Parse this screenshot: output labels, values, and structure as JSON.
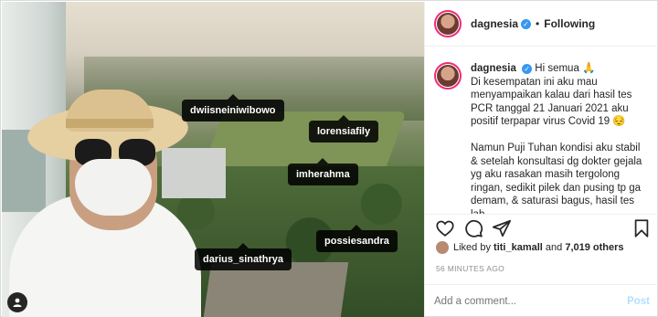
{
  "post": {
    "username": "dagnesia",
    "follow_status": "Following",
    "tags": [
      "dwiisneiniwibowo",
      "lorensiafily",
      "imherahma",
      "possiesandra",
      "darius_sinathrya"
    ],
    "caption": {
      "username": "dagnesia",
      "line1": "Hi semua 🙏",
      "para1": "Di kesempatan ini aku mau menyampaikan kalau dari hasil tes PCR tanggal 21 Januari 2021 aku positif terpapar virus Covid 19 😔",
      "para2": "Namun Puji Tuhan kondisi aku stabil & setelah konsultasi dg dokter gejala yg aku rasakan masih tergolong ringan, sedikit pilek dan pusing tp ga demam, & saturasi bagus, hasil tes lab"
    },
    "likes": {
      "prefix": "Liked by",
      "user": "titi_kamall",
      "and": "and",
      "others": "7,019 others"
    },
    "time_ago": "56 MINUTES AGO",
    "comment_placeholder": "Add a comment...",
    "post_label": "Post"
  },
  "icons": {
    "verified": "verified-badge-icon",
    "like": "heart-icon",
    "comment": "comment-icon",
    "share": "paper-plane-icon",
    "save": "bookmark-icon",
    "tagged_users": "user-icon"
  },
  "colors": {
    "story_ring": "#ee2a7b",
    "verified": "#3897f0",
    "post_button": "#b2dffc"
  }
}
